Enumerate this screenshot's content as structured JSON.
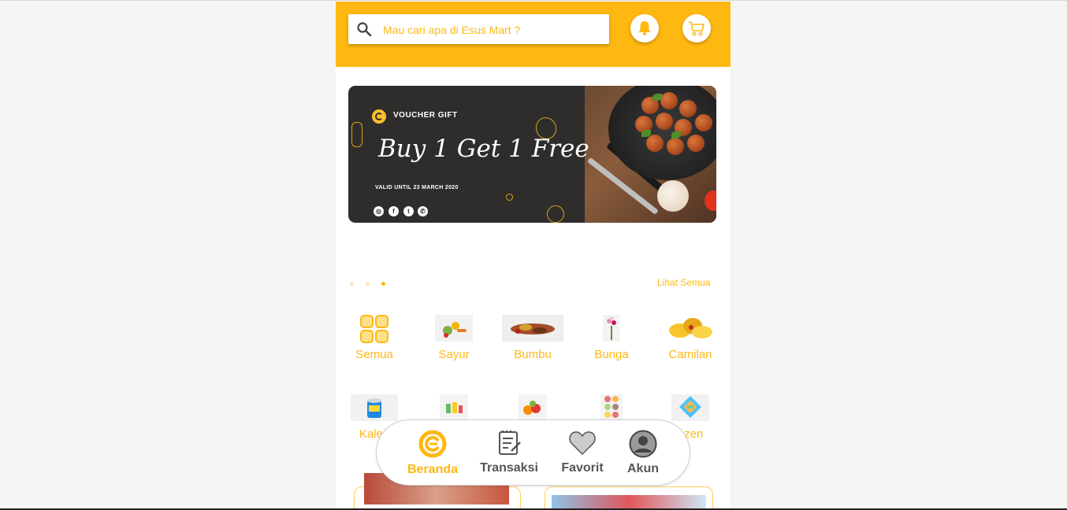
{
  "search": {
    "placeholder": "Mau cari apa di Esus Mart ?",
    "icon": "search-icon"
  },
  "header_actions": [
    {
      "name": "notification",
      "icon": "bell-icon"
    },
    {
      "name": "cart",
      "icon": "cart-icon"
    }
  ],
  "banner": {
    "label": "VOUCHER GIFT",
    "title": "Buy 1 Get 1 Free",
    "valid": "VALID UNTIL 23 MARCH 2020",
    "social_icons": [
      "instagram-icon",
      "facebook-icon",
      "twitter-icon",
      "whatsapp-icon"
    ],
    "slide_count": 3,
    "active_slide": 3
  },
  "categories_link": "Lihat Semua",
  "categories_row1": [
    {
      "label": "Semua",
      "icon": "grid-icon"
    },
    {
      "label": "Sayur",
      "icon": "vegetables-image"
    },
    {
      "label": "Bumbu",
      "icon": "spices-image"
    },
    {
      "label": "Bunga",
      "icon": "flowers-image"
    },
    {
      "label": "Camilan",
      "icon": "snacks-image"
    }
  ],
  "categories_row2": [
    {
      "label": "Kalen",
      "icon": "canned-food-image"
    },
    {
      "label": "",
      "icon": "drinks-image"
    },
    {
      "label": "",
      "icon": "fruits-image"
    },
    {
      "label": "",
      "icon": "ready-meals-image"
    },
    {
      "label": "ozen",
      "icon": "frozen-food-image"
    }
  ],
  "bottom_nav": [
    {
      "label": "Beranda",
      "icon": "home-logo-icon",
      "active": true
    },
    {
      "label": "Transaksi",
      "icon": "clipboard-icon",
      "active": false
    },
    {
      "label": "Favorit",
      "icon": "heart-icon",
      "active": false
    },
    {
      "label": "Akun",
      "icon": "user-icon",
      "active": false
    }
  ],
  "colors": {
    "accent": "#ffb811",
    "nav_inactive": "#555555",
    "banner_bg": "#2e2d2b"
  }
}
